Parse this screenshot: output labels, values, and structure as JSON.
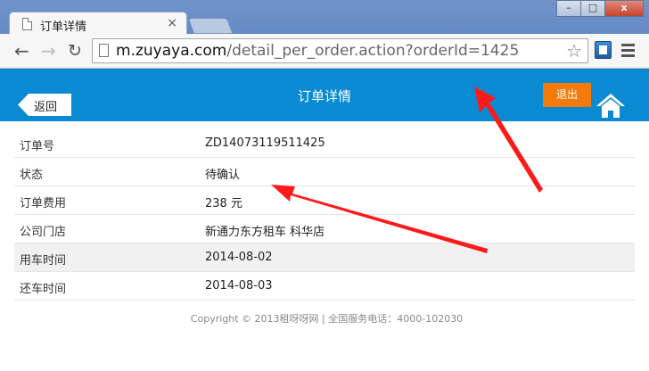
{
  "browser": {
    "tab_title": "订单详情",
    "tab_close": "×",
    "url_host": "m.zuyaya.com",
    "url_path": "/detail_per_order.action?orderId=1425",
    "window_buttons": {
      "minimize": "–",
      "maximize": "□",
      "close": "x"
    }
  },
  "header": {
    "back_label": "返回",
    "title": "订单详情",
    "logout_label": "退出",
    "header_color": "#0a8ad2",
    "logout_color": "#f47b0b"
  },
  "details": {
    "rows": [
      {
        "label": "订单号",
        "value": "ZD14073119511425"
      },
      {
        "label": "状态",
        "value": "待确认"
      },
      {
        "label": "订单费用",
        "value": "238 元"
      },
      {
        "label": "公司门店",
        "value": "新通力东方租车 科华店"
      },
      {
        "label": "用车时间",
        "value": "2014-08-02"
      },
      {
        "label": "还车时间",
        "value": "2014-08-03"
      }
    ]
  },
  "footer": {
    "copyright": "Copyright © 2013租呀呀网 | 全国服务电话：4000-102030"
  },
  "annotations": {
    "arrow_color": "#ff1a1a"
  }
}
